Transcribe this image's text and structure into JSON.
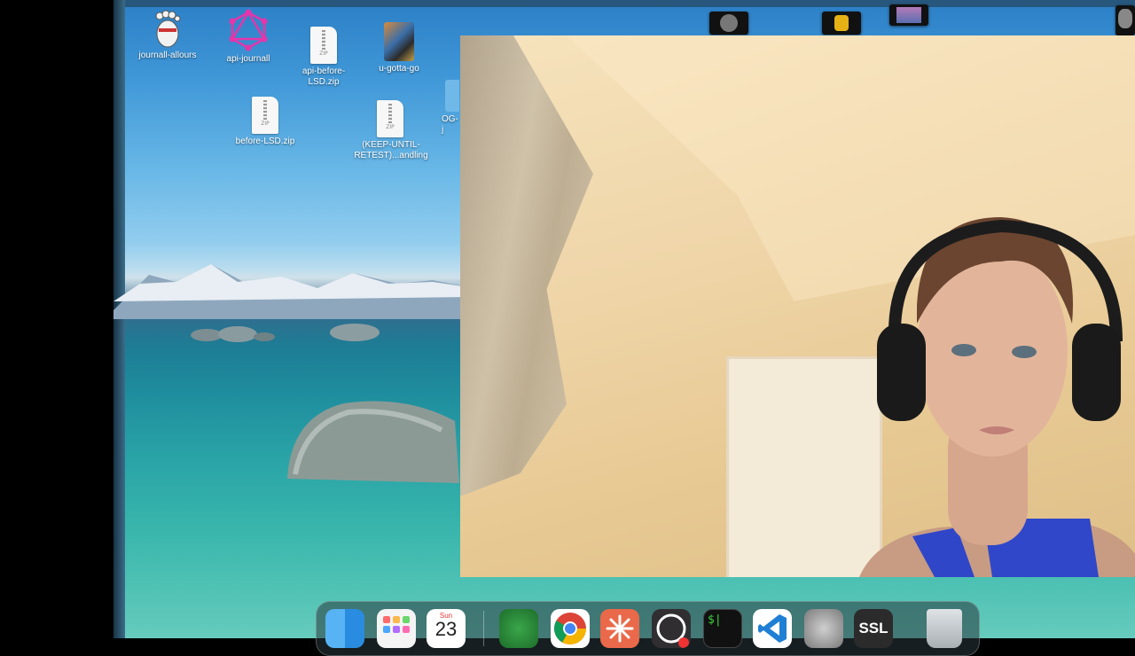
{
  "desktop": {
    "icons": [
      {
        "label": "journall-allours",
        "icon": "footprint-app-icon"
      },
      {
        "label": "api-journall",
        "icon": "graphql-icon"
      },
      {
        "label": "api-before-LSD.zip",
        "icon": "zip-file-icon"
      },
      {
        "label": "u-gotta-go",
        "icon": "image-file-icon"
      },
      {
        "label": "before-LSD.zip",
        "icon": "zip-file-icon"
      },
      {
        "label": "(KEEP-UNTIL-RETEST)...andling",
        "icon": "zip-file-icon"
      },
      {
        "label": "OG-j",
        "icon": "folder-icon"
      }
    ],
    "zip_badge": "ZIP"
  },
  "calendar": {
    "month": "Sun",
    "day": "23"
  },
  "dock": {
    "apps": [
      "finder",
      "launchpad",
      "calendar",
      "sweeper",
      "chrome",
      "claude",
      "obs",
      "terminal",
      "vscode",
      "disk-utility",
      "ssl",
      "trash"
    ],
    "ssl_label": "SSL",
    "terminal_label": "$|"
  },
  "colors": {
    "graphql": "#e535ab",
    "vscode": "#1f7fd4",
    "chrome_red": "#db4437",
    "obs": "#302e31"
  }
}
